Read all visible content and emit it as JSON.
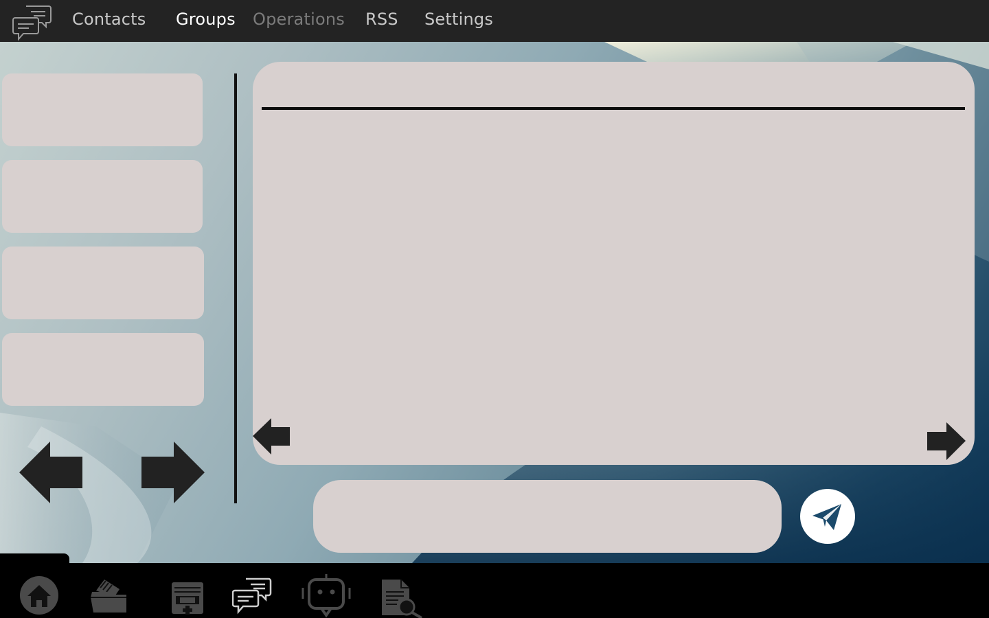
{
  "nav": {
    "items": [
      {
        "label": "Contacts",
        "state": "normal"
      },
      {
        "label": "Groups",
        "state": "active"
      },
      {
        "label": "Operations",
        "state": "disabled"
      },
      {
        "label": "RSS",
        "state": "normal"
      },
      {
        "label": "Settings",
        "state": "normal"
      }
    ]
  },
  "sidebar": {
    "items": [
      "",
      "",
      "",
      ""
    ]
  },
  "chat": {
    "header_title": "",
    "messages": []
  },
  "composer": {
    "placeholder": "",
    "value": ""
  },
  "dock": {
    "icons": [
      "home-icon",
      "notes-folder-icon",
      "medical-record-icon",
      "chat-bubbles-icon",
      "bot-icon",
      "document-search-icon"
    ]
  },
  "colors": {
    "topbar": "#232323",
    "panel": "#d8d0cf",
    "nav_active": "#ffffff",
    "nav_normal": "#c8c8c8",
    "nav_disabled": "#7b7b7b",
    "icon_dark": "#222222",
    "send_icon": "#1b4a6b"
  }
}
